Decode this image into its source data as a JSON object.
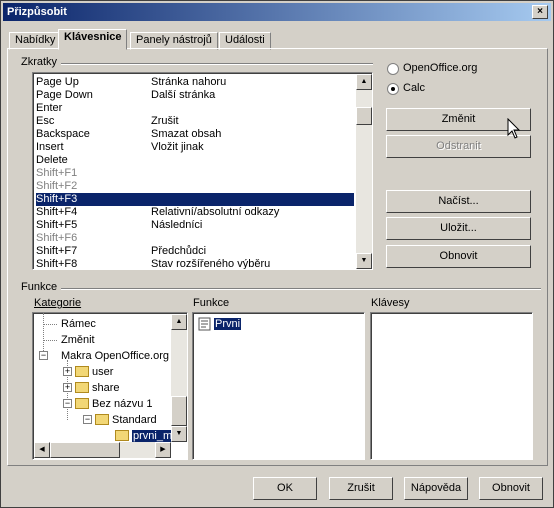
{
  "window": {
    "title": "Přizpůsobit",
    "close": "×"
  },
  "tabs": [
    {
      "label": "Nabídky"
    },
    {
      "label": "Klávesnice"
    },
    {
      "label": "Panely nástrojů"
    },
    {
      "label": "Události"
    }
  ],
  "shortcuts": {
    "label": "Zkratky",
    "rows": [
      {
        "key": "Page Up",
        "cmd": "Stránka nahoru",
        "state": "normal"
      },
      {
        "key": "Page Down",
        "cmd": "Další stránka",
        "state": "normal"
      },
      {
        "key": "Enter",
        "cmd": "",
        "state": "normal"
      },
      {
        "key": "Esc",
        "cmd": "Zrušit",
        "state": "normal"
      },
      {
        "key": "Backspace",
        "cmd": "Smazat obsah",
        "state": "normal"
      },
      {
        "key": "Insert",
        "cmd": "Vložit jinak",
        "state": "normal"
      },
      {
        "key": "Delete",
        "cmd": "",
        "state": "normal"
      },
      {
        "key": "Shift+F1",
        "cmd": "",
        "state": "disabled"
      },
      {
        "key": "Shift+F2",
        "cmd": "",
        "state": "disabled"
      },
      {
        "key": "Shift+F3",
        "cmd": "",
        "state": "selected"
      },
      {
        "key": "Shift+F4",
        "cmd": "Relativní/absolutní odkazy",
        "state": "normal"
      },
      {
        "key": "Shift+F5",
        "cmd": "Následníci",
        "state": "normal"
      },
      {
        "key": "Shift+F6",
        "cmd": "",
        "state": "disabled"
      },
      {
        "key": "Shift+F7",
        "cmd": "Předchůdci",
        "state": "normal"
      },
      {
        "key": "Shift+F8",
        "cmd": "Stav rozšířeného výběru",
        "state": "normal"
      }
    ]
  },
  "scope": {
    "options": [
      {
        "label": "OpenOffice.org",
        "selected": false
      },
      {
        "label": "Calc",
        "selected": true
      }
    ]
  },
  "side_buttons": {
    "change": "Změnit",
    "delete": "Odstranit",
    "load": "Načíst...",
    "save": "Uložit...",
    "reset": "Obnovit"
  },
  "functions": {
    "label": "Funkce",
    "category_label": "Kategorie",
    "function_label": "Funkce",
    "keys_label": "Klávesy",
    "tree": [
      {
        "label": "Rámec"
      },
      {
        "label": "Změnit"
      },
      {
        "label": "Makra OpenOffice.org"
      },
      {
        "label": "user"
      },
      {
        "label": "share"
      },
      {
        "label": "Bez názvu 1"
      },
      {
        "label": "Standard"
      },
      {
        "label": "prvni_m"
      }
    ],
    "function_items": [
      {
        "label": "Prvni"
      }
    ]
  },
  "footer": {
    "ok": "OK",
    "cancel": "Zrušit",
    "help": "Nápověda",
    "reset": "Obnovit"
  }
}
